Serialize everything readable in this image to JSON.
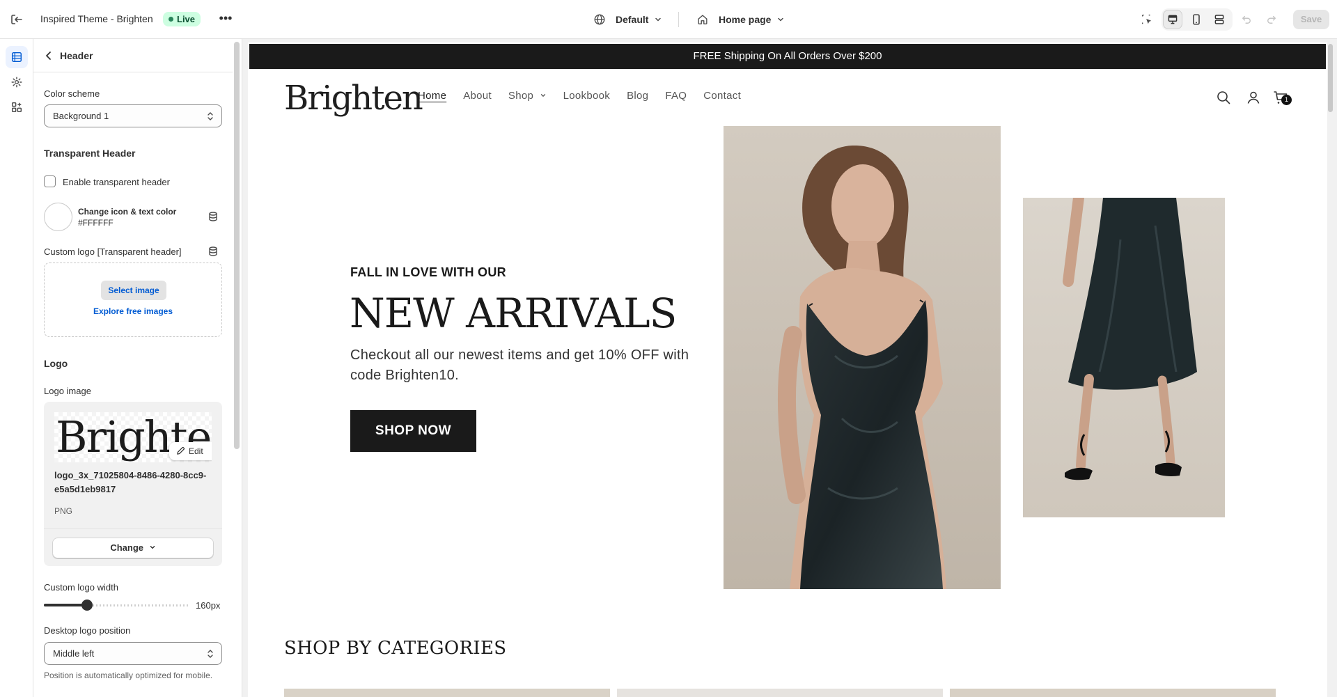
{
  "topbar": {
    "theme_title": "Inspired Theme - Brighten",
    "live_badge": "Live",
    "more_label": "•••",
    "locale_label": "Default",
    "page_label": "Home page",
    "save_label": "Save"
  },
  "panel": {
    "title": "Header",
    "color_scheme_label": "Color scheme",
    "color_scheme_value": "Background 1",
    "transparent_heading": "Transparent Header",
    "enable_transparent_label": "Enable transparent header",
    "enable_transparent_checked": false,
    "icon_color_label": "Change icon & text color",
    "icon_color_value": "#FFFFFF",
    "custom_logo_transparent_label": "Custom logo [Transparent header]",
    "select_image_label": "Select image",
    "explore_images_label": "Explore free images",
    "logo_heading": "Logo",
    "logo_image_label": "Logo image",
    "logo_preview_text": "Brighten",
    "edit_label": "Edit",
    "file_name": "logo_3x_71025804-8486-4280-8cc9-e5a5d1eb9817",
    "file_type": "PNG",
    "change_label": "Change",
    "logo_width_label": "Custom logo width",
    "logo_width_value": "160px",
    "logo_width_fraction": 0.3,
    "desktop_position_label": "Desktop logo position",
    "desktop_position_value": "Middle left",
    "help_text": "Position is automatically optimized for mobile."
  },
  "preview": {
    "announcement": "FREE Shipping On All Orders Over $200",
    "logo": "Brighten",
    "nav": [
      "Home",
      "About",
      "Shop",
      "Lookbook",
      "Blog",
      "FAQ",
      "Contact"
    ],
    "cart_count": "1",
    "hero_kicker": "FALL IN LOVE WITH OUR",
    "hero_title": "NEW ARRIVALS",
    "hero_subtitle": "Checkout all our newest items and get 10% OFF with code Brighten10.",
    "hero_button": "SHOP NOW",
    "categories_title": "SHOP BY CATEGORIES"
  },
  "colors": {
    "accent_link": "#005bd3",
    "live_bg": "#cdfee1",
    "dark": "#1a1a1a"
  }
}
